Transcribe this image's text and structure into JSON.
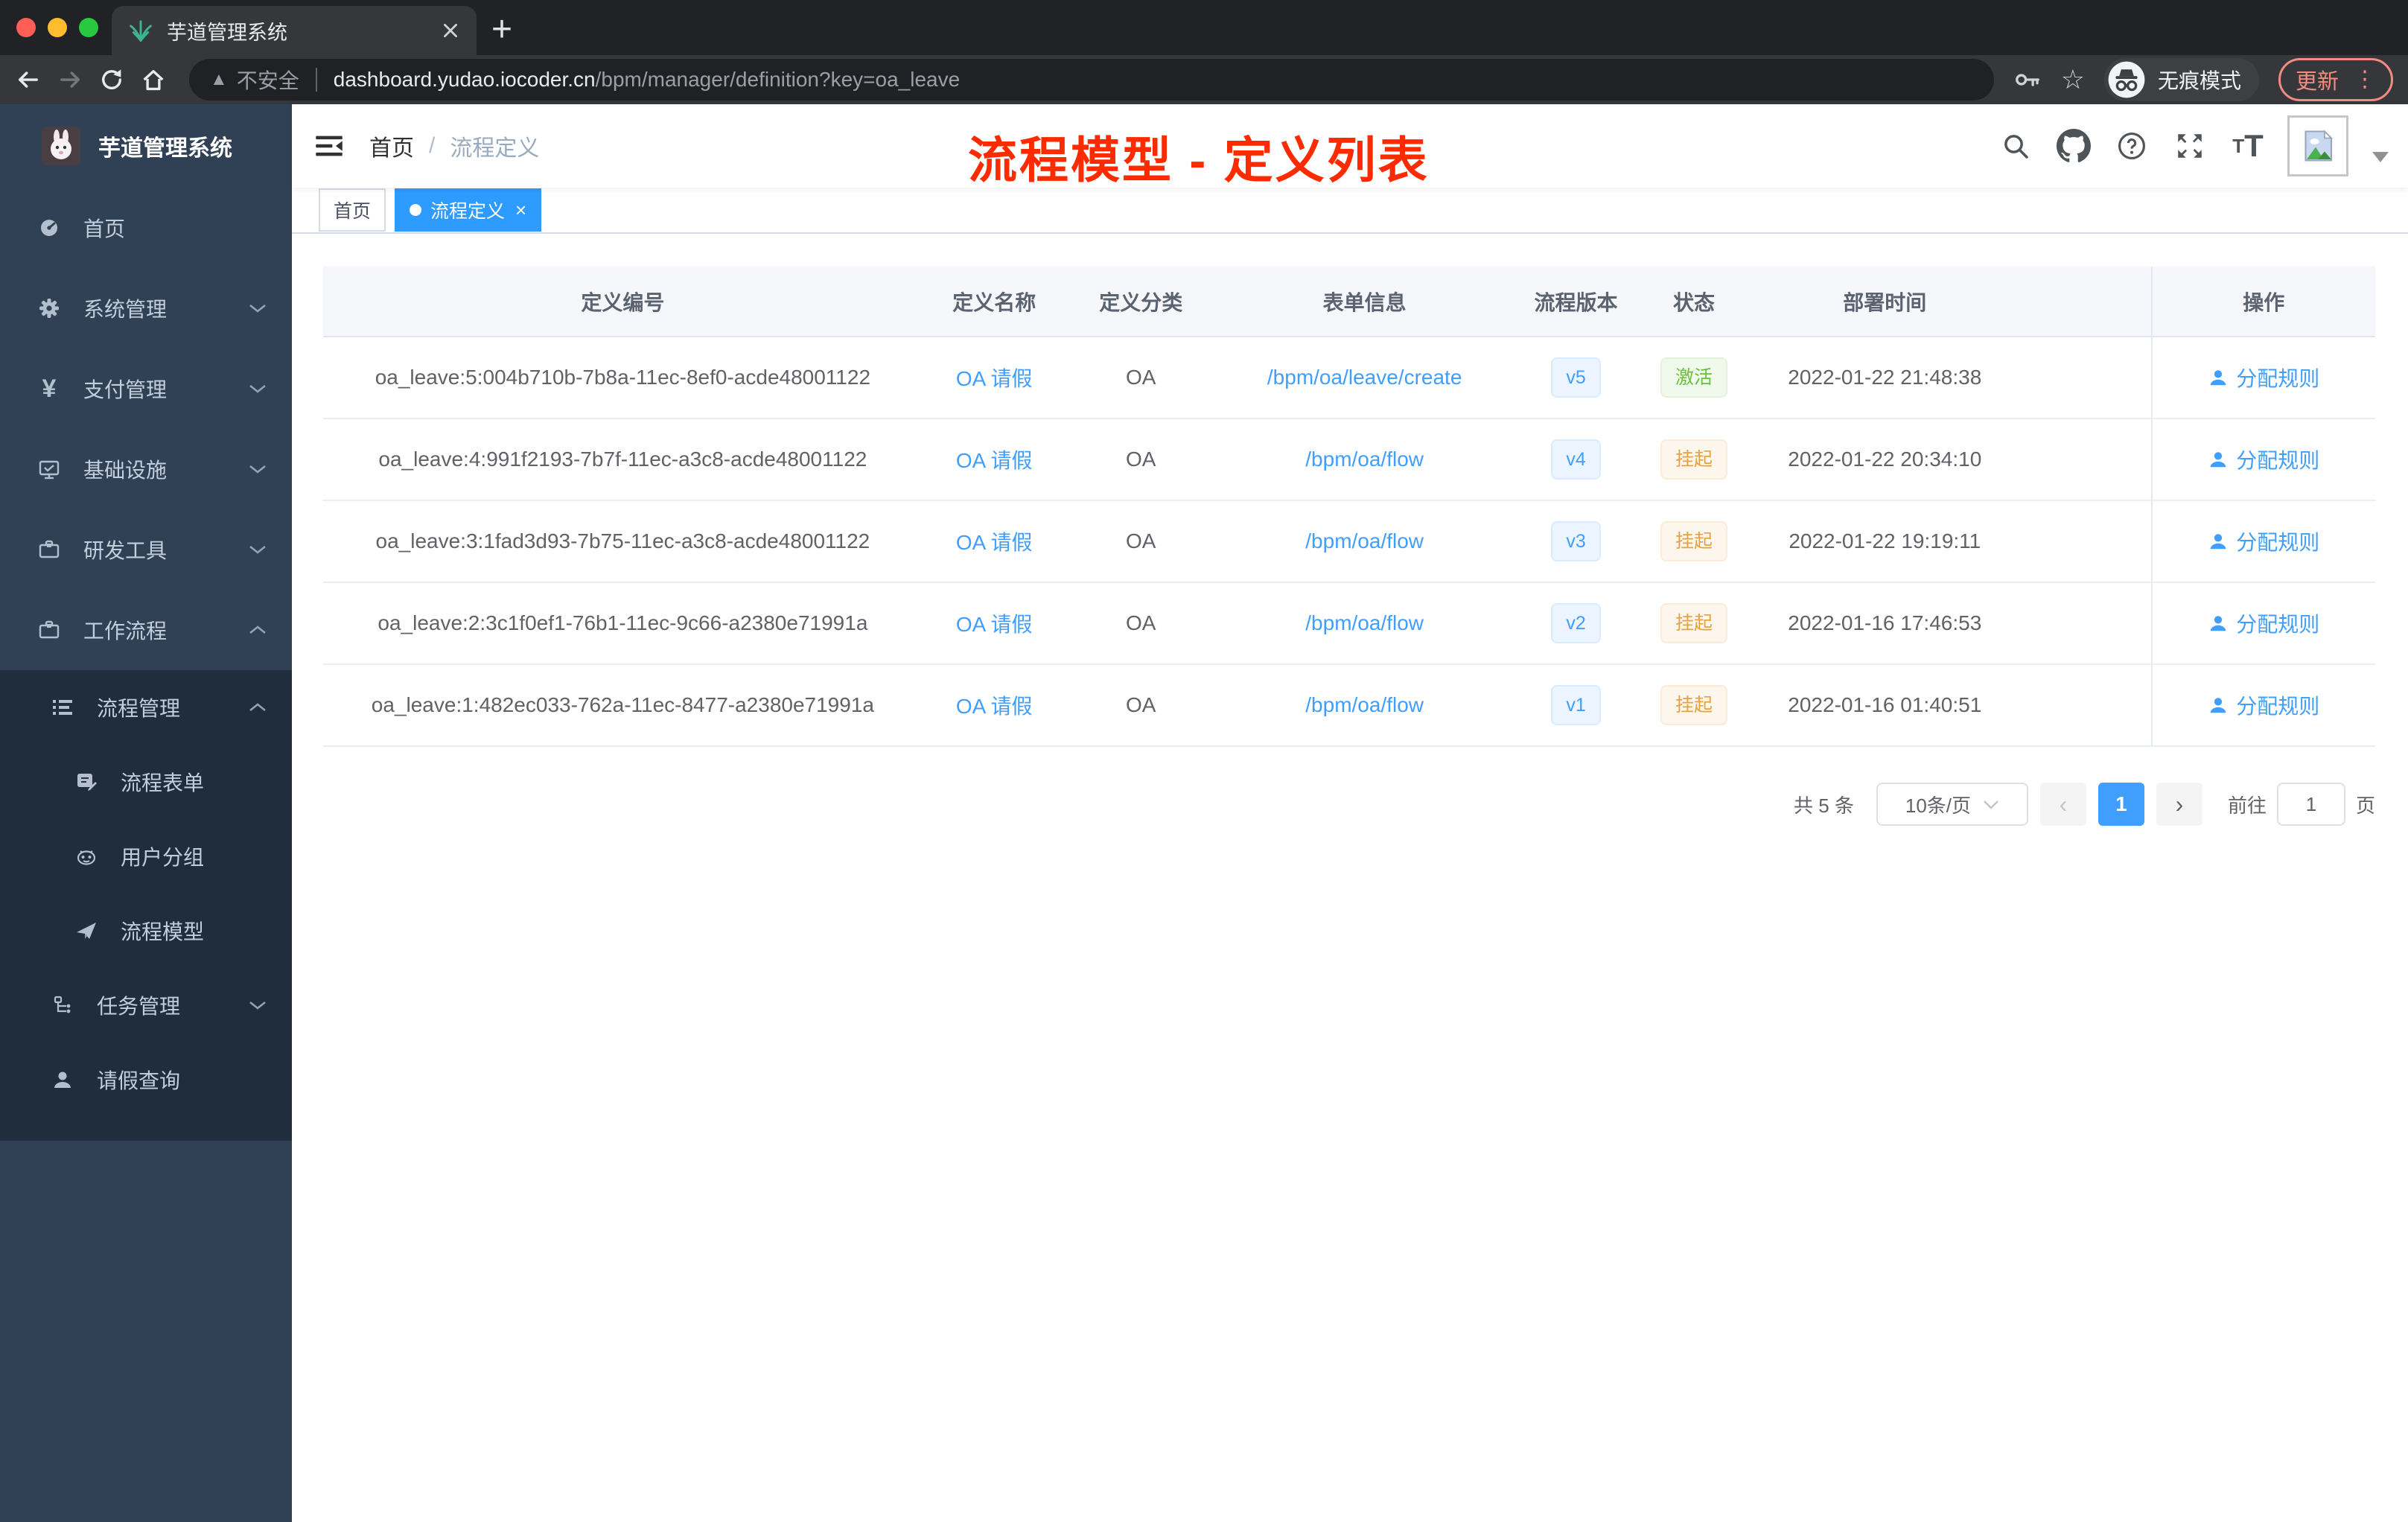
{
  "browser": {
    "tab_title": "芋道管理系统",
    "security_label": "不安全",
    "url_domain": "dashboard.yudao.iocoder.cn",
    "url_path": "/bpm/manager/definition?key=oa_leave",
    "incognito_label": "无痕模式",
    "update_label": "更新"
  },
  "sidebar": {
    "title": "芋道管理系统",
    "items": [
      {
        "label": "首页"
      },
      {
        "label": "系统管理"
      },
      {
        "label": "支付管理"
      },
      {
        "label": "基础设施"
      },
      {
        "label": "研发工具"
      },
      {
        "label": "工作流程"
      },
      {
        "label": "流程管理"
      },
      {
        "label": "流程表单"
      },
      {
        "label": "用户分组"
      },
      {
        "label": "流程模型"
      },
      {
        "label": "任务管理"
      },
      {
        "label": "请假查询"
      }
    ]
  },
  "navbar": {
    "breadcrumb_home": "首页",
    "breadcrumb_separator": "/",
    "breadcrumb_current": "流程定义"
  },
  "tags": {
    "home": "首页",
    "active": "流程定义"
  },
  "annotation": {
    "text": "流程模型 - 定义列表",
    "color": "#fe2b00"
  },
  "table": {
    "headers": [
      "定义编号",
      "定义名称",
      "定义分类",
      "表单信息",
      "流程版本",
      "状态",
      "部署时间",
      "操作"
    ],
    "rows": [
      {
        "id": "oa_leave:5:004b710b-7b8a-11ec-8ef0-acde48001122",
        "name": "OA 请假",
        "category": "OA",
        "form": "/bpm/oa/leave/create",
        "version": "v5",
        "status": "激活",
        "time": "2022-01-22 21:48:38",
        "action": "分配规则"
      },
      {
        "id": "oa_leave:4:991f2193-7b7f-11ec-a3c8-acde48001122",
        "name": "OA 请假",
        "category": "OA",
        "form": "/bpm/oa/flow",
        "version": "v4",
        "status": "挂起",
        "time": "2022-01-22 20:34:10",
        "action": "分配规则"
      },
      {
        "id": "oa_leave:3:1fad3d93-7b75-11ec-a3c8-acde48001122",
        "name": "OA 请假",
        "category": "OA",
        "form": "/bpm/oa/flow",
        "version": "v3",
        "status": "挂起",
        "time": "2022-01-22 19:19:11",
        "action": "分配规则"
      },
      {
        "id": "oa_leave:2:3c1f0ef1-76b1-11ec-9c66-a2380e71991a",
        "name": "OA 请假",
        "category": "OA",
        "form": "/bpm/oa/flow",
        "version": "v2",
        "status": "挂起",
        "time": "2022-01-16 17:46:53",
        "action": "分配规则"
      },
      {
        "id": "oa_leave:1:482ec033-762a-11ec-8477-a2380e71991a",
        "name": "OA 请假",
        "category": "OA",
        "form": "/bpm/oa/flow",
        "version": "v1",
        "status": "挂起",
        "time": "2022-01-16 01:40:51",
        "action": "分配规则"
      }
    ]
  },
  "pagination": {
    "total": "共 5 条",
    "page_size": "10条/页",
    "prev": "‹",
    "page": "1",
    "next": "›",
    "goto_label": "前往",
    "goto_value": "1",
    "page_unit": "页"
  },
  "colors": {
    "accent": "#409eff",
    "sidebar_bg": "#304156",
    "submenu_bg": "#1f2d3d",
    "success": "#67c23a",
    "warning": "#e6a23c",
    "annotation_red": "#fe2b00"
  }
}
